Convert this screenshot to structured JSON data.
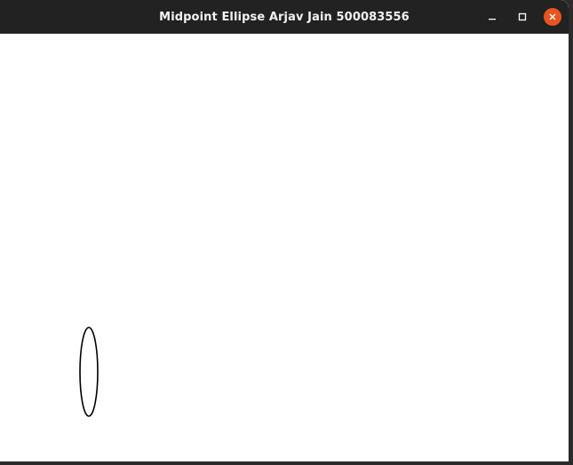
{
  "window": {
    "title": "Midpoint Ellipse Arjav Jain 500083556"
  },
  "titlebar_buttons": {
    "minimize_icon": "minimize-icon",
    "maximize_icon": "maximize-icon",
    "close_icon": "close-icon",
    "close_color": "#e95420"
  },
  "canvas": {
    "background": "#ffffff",
    "shape": "ellipse",
    "stroke_color": "#000000"
  }
}
